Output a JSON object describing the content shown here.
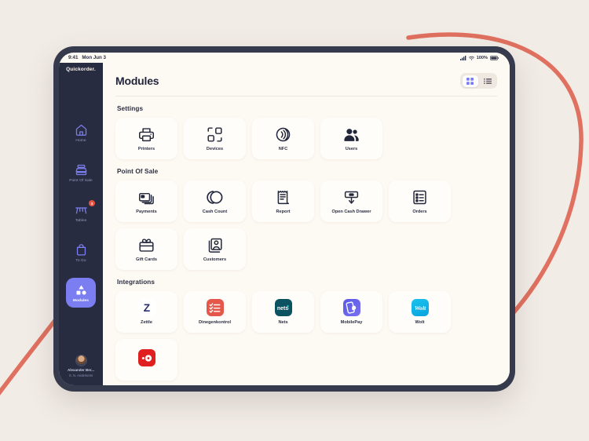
{
  "colors": {
    "background": "#f2ece7",
    "decor_curve": "#e0705f",
    "tablet_frame": "#363a4d",
    "screen": "#fdf9f3",
    "sidebar": "#282c41",
    "accent": "#7b7ef0",
    "badge": "#e8533f",
    "ink": "#22263a"
  },
  "statusbar": {
    "time": "9:41",
    "date": "Mon Jun 3",
    "battery": "100%",
    "signal_icon": "cellular-signal-icon",
    "wifi_icon": "wifi-icon",
    "battery_icon": "battery-icon"
  },
  "sidebar": {
    "brand": "Quickorder.",
    "items": [
      {
        "label": "Home",
        "icon": "home-icon",
        "active": false,
        "badge": null
      },
      {
        "label": "Point Of Sale",
        "icon": "register-icon",
        "active": false,
        "badge": null
      },
      {
        "label": "Tables",
        "icon": "table-icon",
        "active": false,
        "badge": "3"
      },
      {
        "label": "To Go",
        "icon": "takeaway-bag-icon",
        "active": false,
        "badge": null
      },
      {
        "label": "Modules",
        "icon": "shapes-icon",
        "active": true,
        "badge": null
      }
    ],
    "user": {
      "name": "Alexander Ber...",
      "subtitle": "S. N. Andersens",
      "avatar_icon": "avatar"
    }
  },
  "header": {
    "title": "Modules",
    "view_toggle": {
      "grid_label": "grid-view",
      "list_label": "list-view",
      "active": "grid"
    }
  },
  "sections": [
    {
      "title": "Settings",
      "cards": [
        {
          "label": "Printers",
          "icon": "printer-icon"
        },
        {
          "label": "Devices",
          "icon": "devices-icon"
        },
        {
          "label": "NFC",
          "icon": "nfc-icon"
        },
        {
          "label": "Users",
          "icon": "users-icon"
        }
      ]
    },
    {
      "title": "Point Of Sale",
      "cards": [
        {
          "label": "Payments",
          "icon": "payment-card-icon"
        },
        {
          "label": "Cash Count",
          "icon": "coins-icon"
        },
        {
          "label": "Report",
          "icon": "receipt-icon"
        },
        {
          "label": "Open Cash Drawer",
          "icon": "cash-drawer-icon"
        },
        {
          "label": "Orders",
          "icon": "orders-list-icon"
        },
        {
          "label": "Gift Cards",
          "icon": "gift-card-icon"
        },
        {
          "label": "Customers",
          "icon": "customers-icon"
        }
      ]
    },
    {
      "title": "Integrations",
      "cards": [
        {
          "label": "Zettle",
          "icon": "zettle-logo",
          "logo_bg": "#ffffff",
          "logo_fg": "#2b2f6e",
          "glyph": "Z"
        },
        {
          "label": "Dinegenkontrol",
          "icon": "dinegenkontrol-logo",
          "logo_bg": "#e4574a",
          "logo_fg": "#ffffff",
          "glyph": "checklist"
        },
        {
          "label": "Nets",
          "icon": "nets-logo",
          "logo_bg": "#0b5360",
          "logo_fg": "#ffffff",
          "glyph": "nets"
        },
        {
          "label": "MobilePay",
          "icon": "mobilepay-logo",
          "logo_bg": "#5a5ae6",
          "logo_fg": "#ffffff",
          "glyph": "phone"
        },
        {
          "label": "Wolt",
          "icon": "wolt-logo",
          "logo_bg": "#12b3e3",
          "logo_fg": "#ffffff",
          "glyph": "Wolt"
        },
        {
          "label": "",
          "icon": "red-app-logo",
          "logo_bg": "#e02020",
          "logo_fg": "#ffffff",
          "glyph": "dots"
        }
      ]
    }
  ]
}
